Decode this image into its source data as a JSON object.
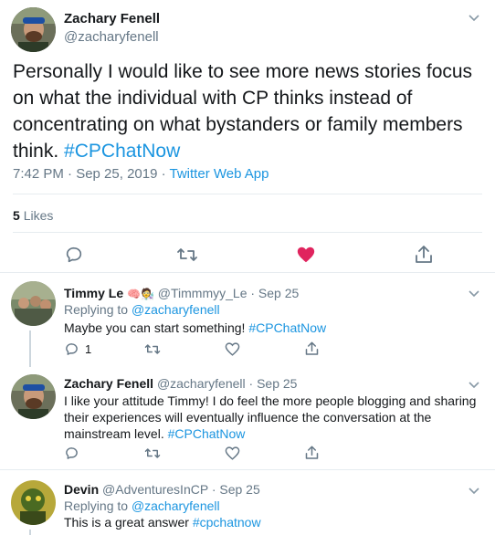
{
  "main_tweet": {
    "name": "Zachary Fenell",
    "handle": "@zacharyfenell",
    "text_main": "Personally I would like to see more news stories focus on what the individual with CP thinks instead of concentrating on what bystanders or family members think.",
    "hashtag": "#CPChatNow",
    "time": "7:42 PM · Sep 25, 2019",
    "via": "Twitter Web App",
    "likes_count": "5",
    "likes_label": "Likes"
  },
  "replies": [
    {
      "name": "Timmy Le",
      "emoji": "🧠🧑‍🔬",
      "handle": "@Timmmyy_Le",
      "date": "· Sep 25",
      "replying_prefix": "Replying to",
      "replying_to": "@zacharyfenell",
      "text": "Maybe you can start something!",
      "hashtag": "#CPChatNow",
      "reply_count": "1"
    },
    {
      "name": "Zachary Fenell",
      "handle": "@zacharyfenell",
      "date": "· Sep 25",
      "text": "I like your attitude Timmy! I do feel the more people blogging and sharing their experiences will eventually influence the conversation at the mainstream level.",
      "hashtag": "#CPChatNow"
    },
    {
      "name": "Devin",
      "handle": "@AdventuresInCP",
      "date": "· Sep 25",
      "replying_prefix": "Replying to",
      "replying_to": "@zacharyfenell",
      "text": "This is a great answer",
      "hashtag": "#cpchatnow"
    }
  ],
  "colors": {
    "accent": "#1b95e0",
    "liked": "#e0245e",
    "muted": "#657786"
  }
}
